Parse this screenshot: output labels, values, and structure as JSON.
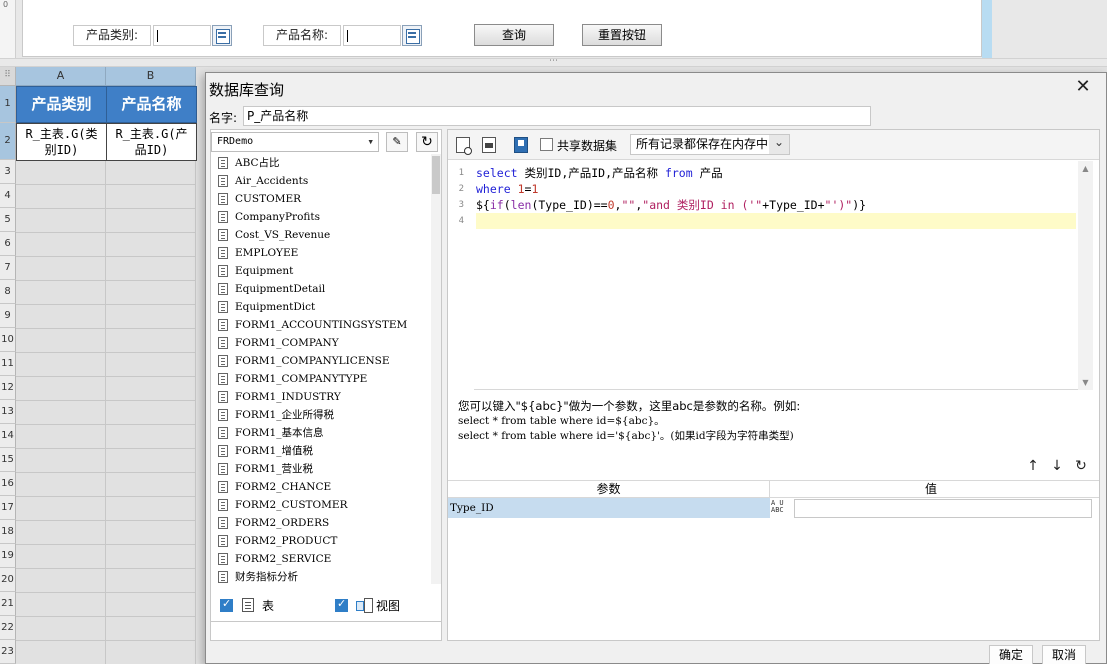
{
  "designer": {
    "ruler_mark": "0",
    "param_pane": {
      "category_label": "产品类别:",
      "name_label": "产品名称:",
      "query_button": "查询",
      "reset_button": "重置按钮"
    },
    "splitter_grip": "⋯"
  },
  "sheet": {
    "columns": [
      "A",
      "B"
    ],
    "rows": [
      "1",
      "2",
      "3",
      "4",
      "5",
      "6",
      "7",
      "8",
      "9",
      "10",
      "11",
      "12",
      "13",
      "14",
      "15",
      "16",
      "17",
      "18",
      "19",
      "20",
      "21",
      "22",
      "23"
    ],
    "header_cells": [
      "产品类别",
      "产品名称"
    ],
    "data_cells": [
      "R_主表.G(类\n别ID)",
      "R_主表.G(产\n品ID)"
    ]
  },
  "dialog": {
    "title": "数据库查询",
    "close_glyph": "✕",
    "name_label": "名字:",
    "name_value": "P_产品名称",
    "datasource": "FRDemo",
    "tables": [
      "ABC占比",
      "Air_Accidents",
      "CUSTOMER",
      "CompanyProfits",
      "Cost_VS_Revenue",
      "EMPLOYEE",
      "Equipment",
      "EquipmentDetail",
      "EquipmentDict",
      "FORM1_ACCOUNTINGSYSTEM",
      "FORM1_COMPANY",
      "FORM1_COMPANYLICENSE",
      "FORM1_COMPANYTYPE",
      "FORM1_INDUSTRY",
      "FORM1_企业所得税",
      "FORM1_基本信息",
      "FORM1_增值税",
      "FORM1_营业税",
      "FORM2_CHANCE",
      "FORM2_CUSTOMER",
      "FORM2_ORDERS",
      "FORM2_PRODUCT",
      "FORM2_SERVICE",
      "财务指标分析"
    ],
    "filter": {
      "table_label": "表",
      "view_label": "视图"
    },
    "toolbar": {
      "share_label": "共享数据集",
      "memory_option": "所有记录都保存在内存中"
    },
    "sql": {
      "line_numbers": [
        "1",
        "2",
        "3",
        "4"
      ],
      "line1": {
        "kw1": "select",
        "t1": " 类别ID,产品ID,产品名称 ",
        "kw2": "from",
        "t2": " 产品"
      },
      "line2": {
        "kw1": "where",
        "t1": " ",
        "n1": "1",
        "t2": "=",
        "n2": "1"
      },
      "line3": {
        "t1": "${",
        "fn1": "if",
        "t2": "(",
        "fn2": "len",
        "t3": "(Type_ID)==",
        "n1": "0",
        "t4": ",",
        "s1": "\"\"",
        "t5": ",",
        "s2": "\"and 类别ID in ('\"",
        "t6": "+Type_ID+",
        "s3": "\"')\"",
        "t7": ")}"
      }
    },
    "hint": {
      "line1": "您可以键入\"${abc}\"做为一个参数，这里abc是参数的名称。例如:",
      "line2": "select * from table where id=${abc}。",
      "line3": "select * from table where id='${abc}'。(如果id字段为字符串类型)"
    },
    "param_table": {
      "col_param": "参数",
      "col_value": "值",
      "rows": [
        {
          "name": "Type_ID",
          "type_icon": "A U ABC",
          "value": ""
        }
      ]
    },
    "ok_label": "确定",
    "cancel_label": "取消"
  }
}
